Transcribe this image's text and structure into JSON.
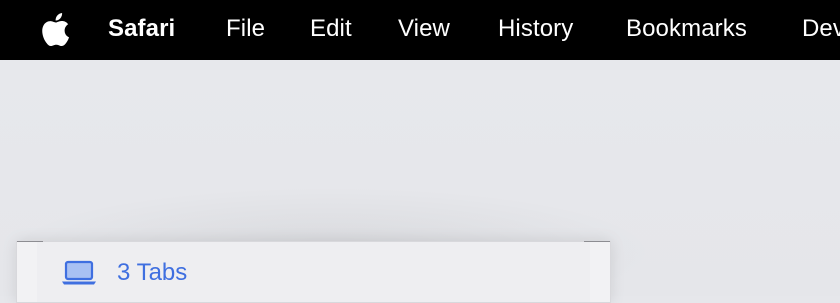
{
  "menubar": {
    "apple_icon": "apple-logo-icon",
    "app_name": "Safari",
    "items": [
      "File",
      "Edit",
      "View",
      "History",
      "Bookmarks",
      "Dev"
    ]
  },
  "tabs_panel": {
    "icon": "laptop-icon",
    "label": "3 Tabs"
  },
  "colors": {
    "menubar_bg": "#000000",
    "desktop_bg": "#e6e7eb",
    "accent": "#3f6fe0"
  }
}
